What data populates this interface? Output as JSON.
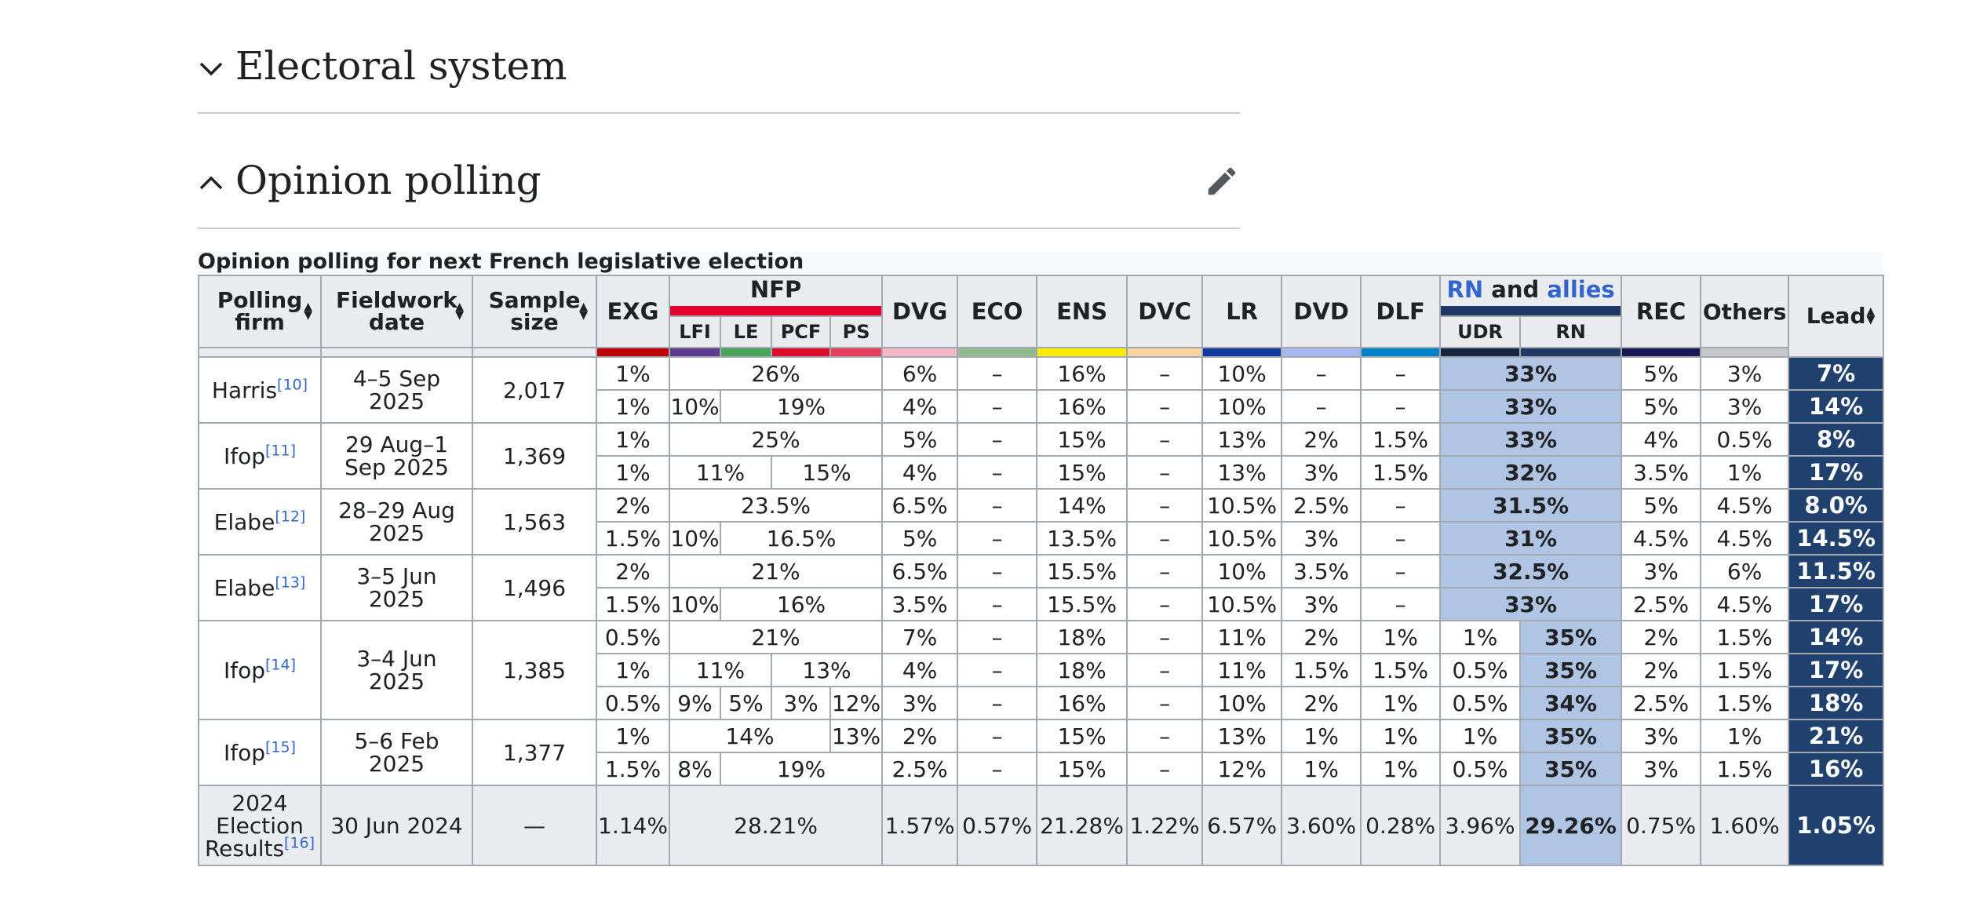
{
  "sections": [
    {
      "title": "Electoral system",
      "expanded": false
    },
    {
      "title": "Opinion polling",
      "expanded": true
    }
  ],
  "table": {
    "caption": "Opinion polling for next French legislative election",
    "headers": {
      "firm": [
        "Polling",
        "firm"
      ],
      "date": [
        "Fieldwork",
        "date"
      ],
      "size": [
        "Sample",
        "size"
      ],
      "exg": "EXG",
      "nfp": "NFP",
      "lfi": "LFI",
      "le": "LE",
      "pcf": "PCF",
      "ps": "PS",
      "dvg": "DVG",
      "eco": "ECO",
      "ens": "ENS",
      "dvc": "DVC",
      "lr": "LR",
      "dvd": "DVD",
      "dlf": "DLF",
      "rn_group": {
        "rn": "RN",
        "and": " and ",
        "allies": "allies"
      },
      "udr": "UDR",
      "rn": "RN",
      "rec": "REC",
      "others": "Others",
      "lead": "Lead"
    },
    "party_colors": {
      "exg": "#bb0000",
      "lfi": "#5e3a8c",
      "le": "#4aa55a",
      "pcf": "#dd0d2c",
      "ps": "#e4405c",
      "dvg": "#f4b8c8",
      "eco": "#8fbd8f",
      "ens": "#ffeb00",
      "dvc": "#f9d3a0",
      "lr": "#0f3a9c",
      "dvd": "#a6b8ee",
      "dlf": "#0082c9",
      "udr": "#18273f",
      "rn": "#203864",
      "rec": "#1a1654",
      "others": "#c8c8c8"
    },
    "polls": {
      "harris": {
        "firm": "Harris",
        "ref": "[10]",
        "date": [
          "4–5 Sep",
          "2025"
        ],
        "size": "2,017",
        "r1": {
          "exg": "1%",
          "nfp": "26%",
          "dvg": "6%",
          "eco": "–",
          "ens": "16%",
          "dvc": "–",
          "lr": "10%",
          "dvd": "–",
          "dlf": "–",
          "rn": "33%",
          "rec": "5%",
          "others": "3%",
          "lead": "7%"
        },
        "r2": {
          "exg": "1%",
          "lfi": "10%",
          "rest": "19%",
          "dvg": "4%",
          "eco": "–",
          "ens": "16%",
          "dvc": "–",
          "lr": "10%",
          "dvd": "–",
          "dlf": "–",
          "rn": "33%",
          "rec": "5%",
          "others": "3%",
          "lead": "14%"
        }
      },
      "ifop1": {
        "firm": "Ifop",
        "ref": "[11]",
        "date": [
          "29 Aug–1",
          "Sep 2025"
        ],
        "size": "1,369",
        "r1": {
          "exg": "1%",
          "nfp": "25%",
          "dvg": "5%",
          "eco": "–",
          "ens": "15%",
          "dvc": "–",
          "lr": "13%",
          "dvd": "2%",
          "dlf": "1.5%",
          "rn": "33%",
          "rec": "4%",
          "others": "0.5%",
          "lead": "8%"
        },
        "r2": {
          "exg": "1%",
          "lfi_le": "11%",
          "pcf_ps": "15%",
          "dvg": "4%",
          "eco": "–",
          "ens": "15%",
          "dvc": "–",
          "lr": "13%",
          "dvd": "3%",
          "dlf": "1.5%",
          "rn": "32%",
          "rec": "3.5%",
          "others": "1%",
          "lead": "17%"
        }
      },
      "elabe1": {
        "firm": "Elabe",
        "ref": "[12]",
        "date": [
          "28–29 Aug",
          "2025"
        ],
        "size": "1,563",
        "r1": {
          "exg": "2%",
          "nfp": "23.5%",
          "dvg": "6.5%",
          "eco": "–",
          "ens": "14%",
          "dvc": "–",
          "lr": "10.5%",
          "dvd": "2.5%",
          "dlf": "–",
          "rn": "31.5%",
          "rec": "5%",
          "others": "4.5%",
          "lead": "8.0%"
        },
        "r2": {
          "exg": "1.5%",
          "lfi": "10%",
          "rest": "16.5%",
          "dvg": "5%",
          "eco": "–",
          "ens": "13.5%",
          "dvc": "–",
          "lr": "10.5%",
          "dvd": "3%",
          "dlf": "–",
          "rn": "31%",
          "rec": "4.5%",
          "others": "4.5%",
          "lead": "14.5%"
        }
      },
      "elabe2": {
        "firm": "Elabe",
        "ref": "[13]",
        "date": [
          "3–5 Jun",
          "2025"
        ],
        "size": "1,496",
        "r1": {
          "exg": "2%",
          "nfp": "21%",
          "dvg": "6.5%",
          "eco": "–",
          "ens": "15.5%",
          "dvc": "–",
          "lr": "10%",
          "dvd": "3.5%",
          "dlf": "–",
          "rn": "32.5%",
          "rec": "3%",
          "others": "6%",
          "lead": "11.5%"
        },
        "r2": {
          "exg": "1.5%",
          "lfi": "10%",
          "rest": "16%",
          "dvg": "3.5%",
          "eco": "–",
          "ens": "15.5%",
          "dvc": "–",
          "lr": "10.5%",
          "dvd": "3%",
          "dlf": "–",
          "rn": "33%",
          "rec": "2.5%",
          "others": "4.5%",
          "lead": "17%"
        }
      },
      "ifop2": {
        "firm": "Ifop",
        "ref": "[14]",
        "date": [
          "3–4 Jun",
          "2025"
        ],
        "size": "1,385",
        "r1": {
          "exg": "0.5%",
          "nfp": "21%",
          "dvg": "7%",
          "eco": "–",
          "ens": "18%",
          "dvc": "–",
          "lr": "11%",
          "dvd": "2%",
          "dlf": "1%",
          "udr": "1%",
          "rn": "35%",
          "rec": "2%",
          "others": "1.5%",
          "lead": "14%"
        },
        "r2": {
          "exg": "1%",
          "lfi_le": "11%",
          "pcf_ps": "13%",
          "dvg": "4%",
          "eco": "–",
          "ens": "18%",
          "dvc": "–",
          "lr": "11%",
          "dvd": "1.5%",
          "dlf": "1.5%",
          "udr": "0.5%",
          "rn": "35%",
          "rec": "2%",
          "others": "1.5%",
          "lead": "17%"
        },
        "r3": {
          "exg": "0.5%",
          "lfi": "9%",
          "le": "5%",
          "pcf": "3%",
          "ps": "12%",
          "dvg": "3%",
          "eco": "–",
          "ens": "16%",
          "dvc": "–",
          "lr": "10%",
          "dvd": "2%",
          "dlf": "1%",
          "udr": "0.5%",
          "rn": "34%",
          "rec": "2.5%",
          "others": "1.5%",
          "lead": "18%"
        }
      },
      "ifop3": {
        "firm": "Ifop",
        "ref": "[15]",
        "date": [
          "5–6 Feb",
          "2025"
        ],
        "size": "1,377",
        "r1": {
          "exg": "1%",
          "lfi_le_pcf": "14%",
          "ps": "13%",
          "dvg": "2%",
          "eco": "–",
          "ens": "15%",
          "dvc": "–",
          "lr": "13%",
          "dvd": "1%",
          "dlf": "1%",
          "udr": "1%",
          "rn": "35%",
          "rec": "3%",
          "others": "1%",
          "lead": "21%"
        },
        "r2": {
          "exg": "1.5%",
          "lfi": "8%",
          "rest": "19%",
          "dvg": "2.5%",
          "eco": "–",
          "ens": "15%",
          "dvc": "–",
          "lr": "12%",
          "dvd": "1%",
          "dlf": "1%",
          "udr": "0.5%",
          "rn": "35%",
          "rec": "3%",
          "others": "1.5%",
          "lead": "16%"
        }
      }
    },
    "result": {
      "label": [
        "2024",
        "Election",
        "Results"
      ],
      "ref": "[16]",
      "date": "30 Jun 2024",
      "size": "—",
      "exg": "1.14%",
      "nfp": "28.21%",
      "dvg": "1.57%",
      "eco": "0.57%",
      "ens": "21.28%",
      "dvc": "1.22%",
      "lr": "6.57%",
      "dvd": "3.60%",
      "dlf": "0.28%",
      "udr": "3.96%",
      "rn": "29.26%",
      "rec": "0.75%",
      "others": "1.60%",
      "lead": "1.05%"
    }
  }
}
